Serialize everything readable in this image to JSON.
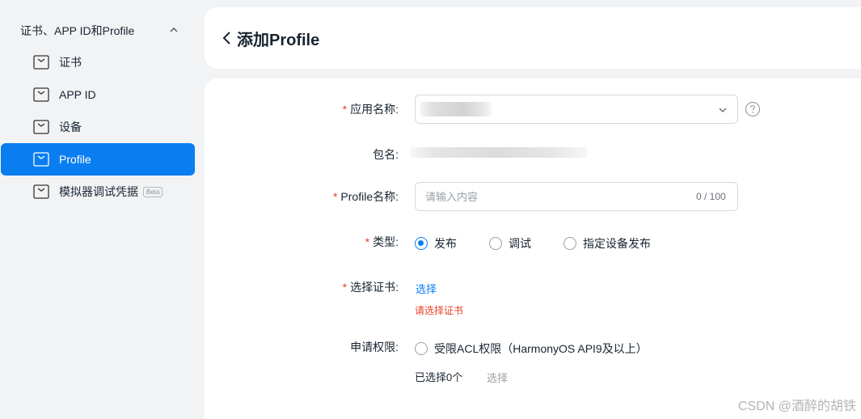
{
  "sidebar": {
    "group_label": "证书、APP ID和Profile",
    "items": [
      {
        "label": "证书"
      },
      {
        "label": "APP ID"
      },
      {
        "label": "设备"
      },
      {
        "label": "Profile"
      },
      {
        "label": "模拟器调试凭据",
        "badge": "Beta"
      }
    ],
    "active_index": 3
  },
  "header": {
    "title": "添加Profile"
  },
  "form": {
    "required_mark": "*",
    "app_name": {
      "label": "应用名称:"
    },
    "package": {
      "label": "包名:"
    },
    "profile_name": {
      "label": "Profile名称:",
      "placeholder": "请输入内容",
      "counter": "0 / 100"
    },
    "type": {
      "label": "类型:",
      "options": [
        "发布",
        "调试",
        "指定设备发布"
      ],
      "selected": "发布"
    },
    "certificate": {
      "label": "选择证书:",
      "link": "选择",
      "error": "请选择证书"
    },
    "permissions": {
      "label": "申请权限:",
      "option": "受限ACL权限（HarmonyOS API9及以上）",
      "selected_count": "已选择0个",
      "select_link": "选择"
    }
  },
  "watermark": "CSDN @酒醉的胡铁",
  "colors": {
    "accent": "#0a7ef0",
    "required": "#e84026",
    "background": "#f1f3f5"
  }
}
